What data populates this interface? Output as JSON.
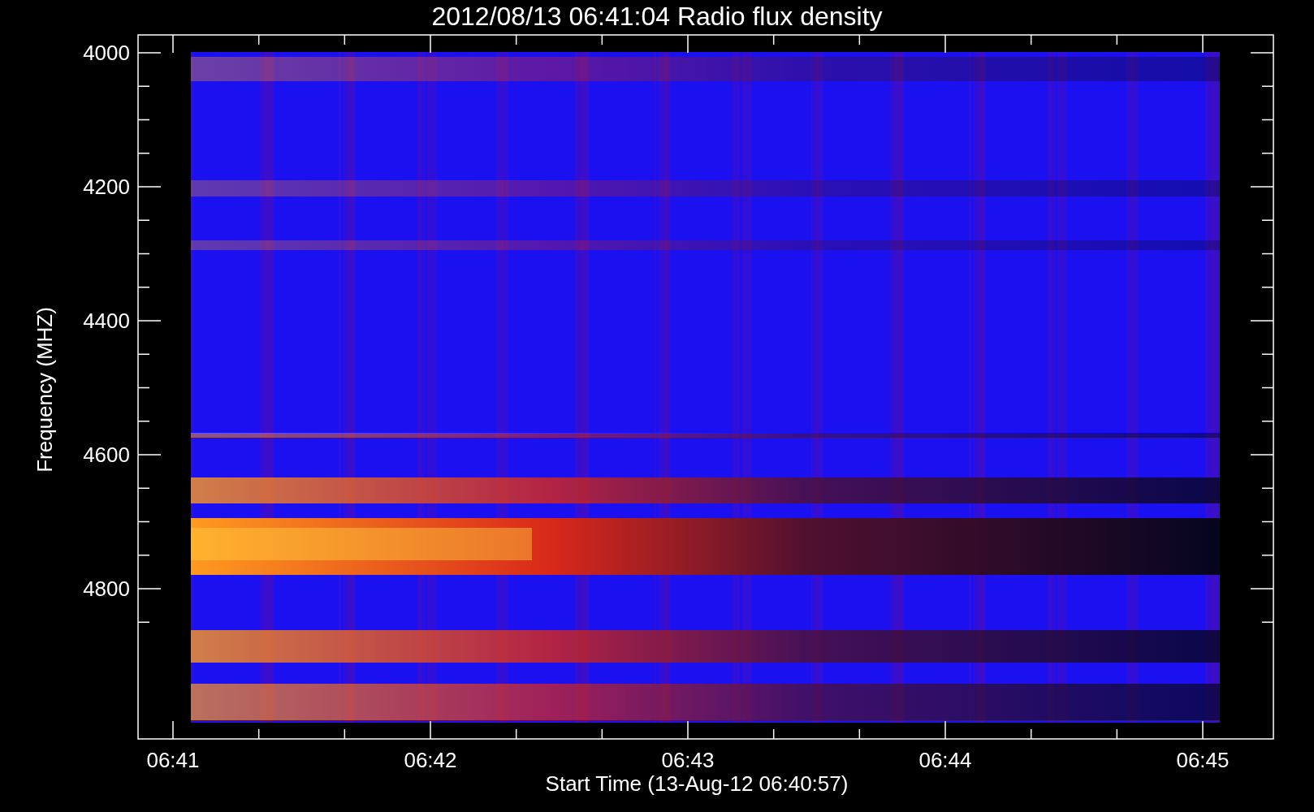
{
  "title": "2012/08/13 06:41:04 Radio flux density",
  "y_axis": {
    "label": "Frequency (MHZ)",
    "ticks": [
      "4000",
      "4200",
      "4400",
      "4600",
      "4800"
    ]
  },
  "x_axis": {
    "label": "Start Time (13-Aug-12 06:40:57)",
    "ticks": [
      "06:41",
      "06:42",
      "06:43",
      "06:44",
      "06:45"
    ]
  }
}
